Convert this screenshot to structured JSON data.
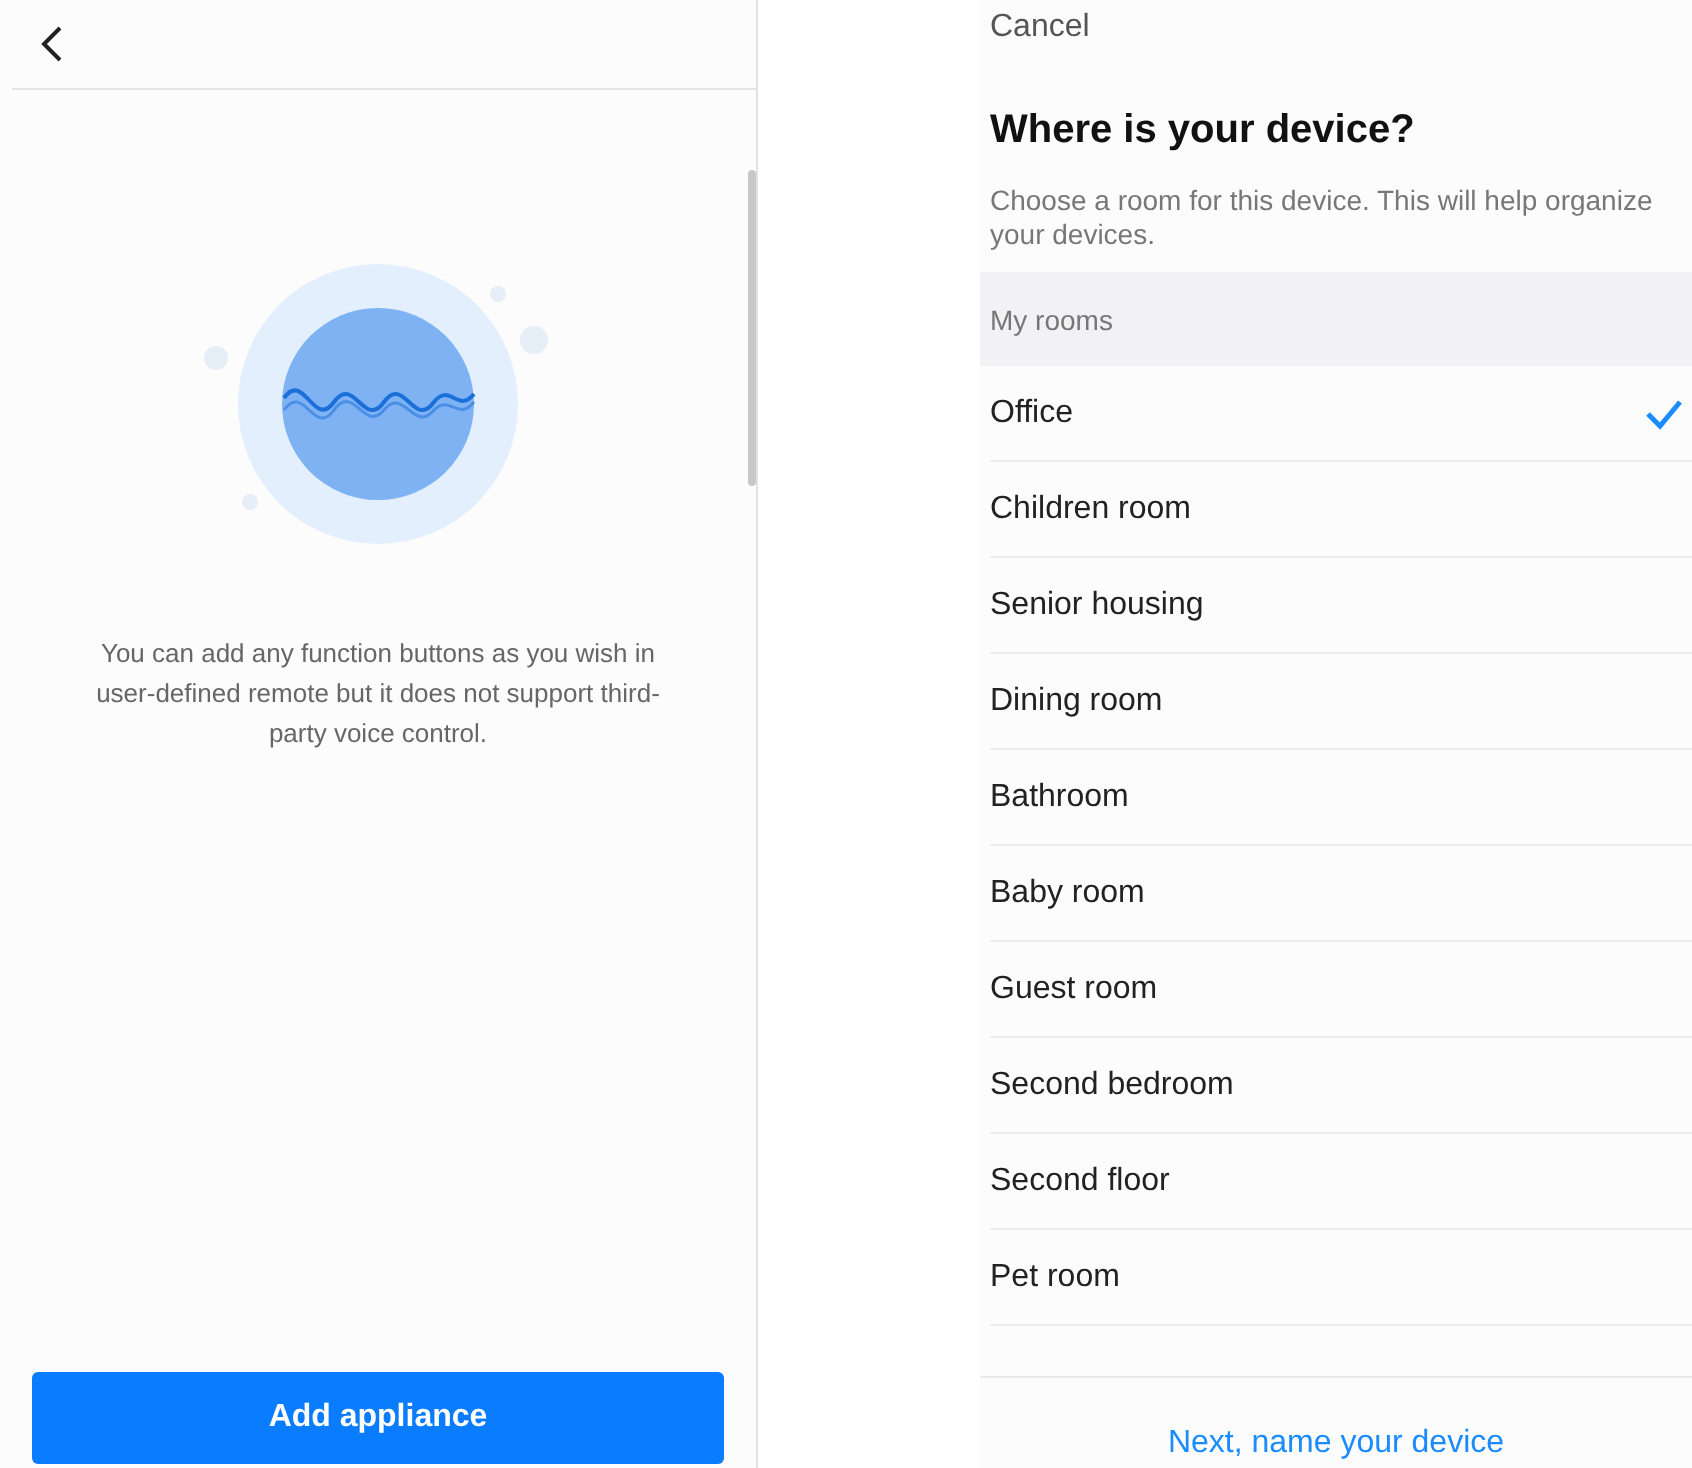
{
  "left": {
    "description": "You can add any function buttons as you wish in user-defined remote but it does not support third-party voice control.",
    "button": "Add appliance"
  },
  "right": {
    "cancel": "Cancel",
    "title": "Where is your device?",
    "subtitle": "Choose a room for this device. This will help organize your devices.",
    "section": "My rooms",
    "rooms": [
      {
        "name": "Office",
        "selected": true
      },
      {
        "name": "Children room",
        "selected": false
      },
      {
        "name": "Senior housing",
        "selected": false
      },
      {
        "name": "Dining room",
        "selected": false
      },
      {
        "name": "Bathroom",
        "selected": false
      },
      {
        "name": "Baby room",
        "selected": false
      },
      {
        "name": "Guest room",
        "selected": false
      },
      {
        "name": "Second bedroom",
        "selected": false
      },
      {
        "name": "Second floor",
        "selected": false
      },
      {
        "name": "Pet room",
        "selected": false
      }
    ],
    "next": "Next, name your device"
  }
}
